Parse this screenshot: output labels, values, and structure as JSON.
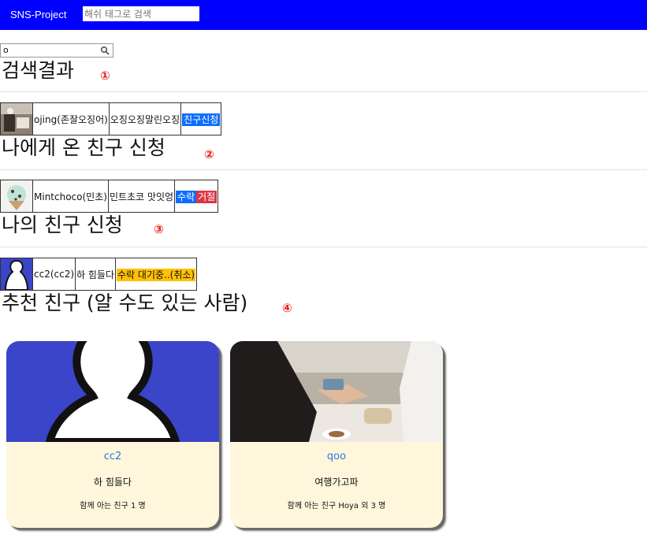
{
  "header": {
    "brand": "SNS-Project",
    "search_placeholder": "해쉬 태그로 검색"
  },
  "search": {
    "value": "o",
    "icon": "search-icon"
  },
  "sections": {
    "search_results": {
      "title": "검색결과",
      "marker": "①"
    },
    "incoming_requests": {
      "title": "나에게 온 친구 신청",
      "marker": "②"
    },
    "my_requests": {
      "title": "나의 친구 신청",
      "marker": "③"
    },
    "recommended": {
      "title": "추천 친구 (알 수도 있는 사람)",
      "marker": "④"
    }
  },
  "search_result_row": {
    "name": "ojing(존잘오징어)",
    "status": "오징오징말린오징",
    "action": "친구신청"
  },
  "incoming_row": {
    "name": "Mintchoco(민초)",
    "status": "민트초코 맛잇엉",
    "accept": "수락",
    "reject": "거절"
  },
  "my_request_row": {
    "name": "cc2(cc2)",
    "status": "하 힘들다",
    "pending": "수락 대기중..(취소)"
  },
  "recommendations": [
    {
      "name": "cc2",
      "status": "하 힘들다",
      "mutual": "함께 아는 친구 1 명"
    },
    {
      "name": "qoo",
      "status": "여행가고파",
      "mutual": "함께 아는 친구 Hoya 외 3 명"
    }
  ],
  "colors": {
    "topbar": "#0000ff",
    "marker": "#e41b1b",
    "primary": "#0d6efd",
    "danger": "#dc3545",
    "warning": "#ffc107",
    "card_bg": "#fff6dc",
    "card_name": "#2a7ae2"
  }
}
